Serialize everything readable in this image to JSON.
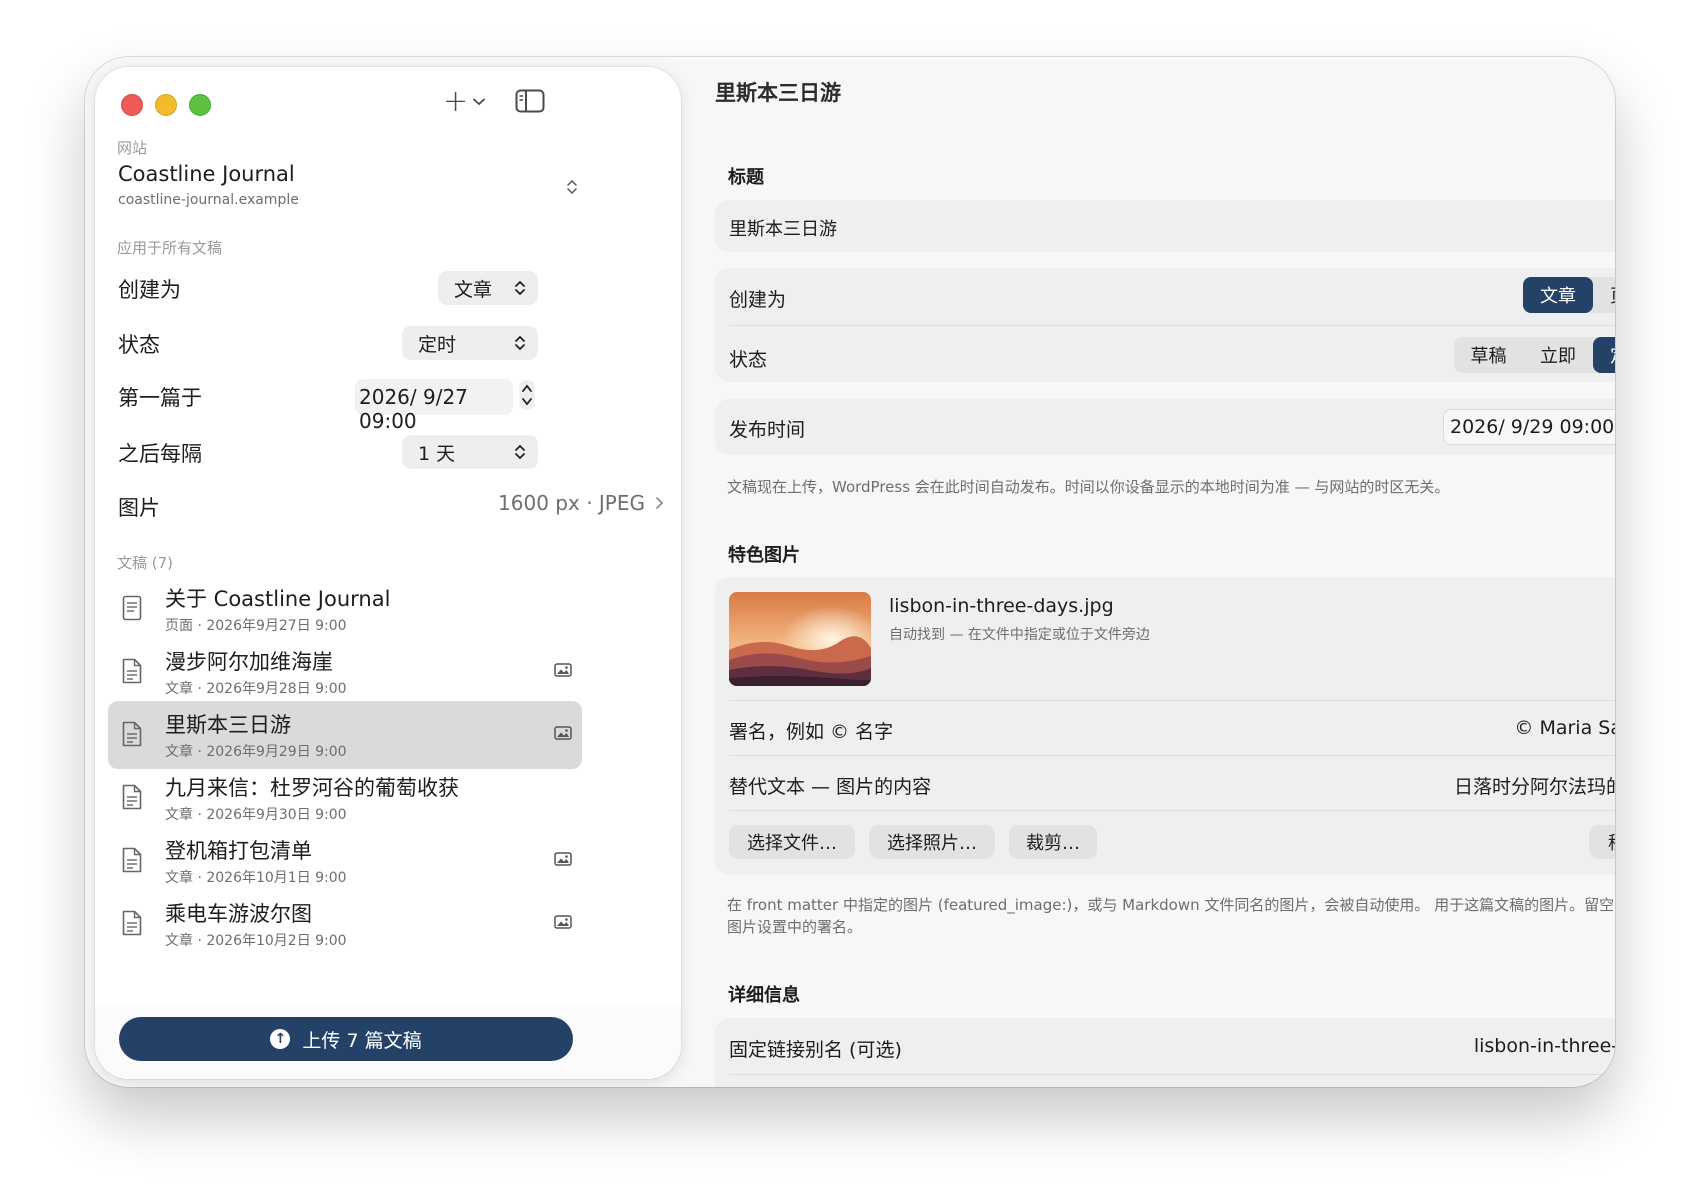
{
  "sidebar": {
    "add_label": "+",
    "site_section_label": "网站",
    "site_name": "Coastline Journal",
    "site_url": "coastline-journal.example",
    "apply_section_label": "应用于所有文稿",
    "create_as_label": "创建为",
    "create_as_value": "文章",
    "status_label": "状态",
    "status_value": "定时",
    "first_at_label": "第一篇于",
    "first_at_value": "2026/  9/27 09:00",
    "interval_label": "之后每隔",
    "interval_value": "1 天",
    "images_label": "图片",
    "images_value": "1600 px · JPEG",
    "docs_section_label": "文稿 (7)",
    "documents": [
      {
        "title": "关于 Coastline Journal",
        "subtitle": "页面 · 2026年9月27日 9:00",
        "icon": "page-icon",
        "has_image": false
      },
      {
        "title": "漫步阿尔加维海崖",
        "subtitle": "文章 · 2026年9月28日 9:00",
        "icon": "document-icon",
        "has_image": true
      },
      {
        "title": "里斯本三日游",
        "subtitle": "文章 · 2026年9月29日 9:00",
        "icon": "document-icon",
        "has_image": true,
        "selected": true
      },
      {
        "title": "九月来信：杜罗河谷的葡萄收获",
        "subtitle": "文章 · 2026年9月30日 9:00",
        "icon": "document-icon",
        "has_image": false
      },
      {
        "title": "登机箱打包清单",
        "subtitle": "文章 · 2026年10月1日 9:00",
        "icon": "document-icon",
        "has_image": true
      },
      {
        "title": "乘电车游波尔图",
        "subtitle": "文章 · 2026年10月2日 9:00",
        "icon": "document-icon",
        "has_image": true
      }
    ],
    "upload_label": "上传 7 篇文稿"
  },
  "main": {
    "title": "里斯本三日游",
    "title_section": "标题",
    "title_value": "里斯本三日游",
    "create_as_label": "创建为",
    "create_as_options": [
      "文章",
      "页面"
    ],
    "create_as_selected": "文章",
    "status_label": "状态",
    "status_options": [
      "草稿",
      "立即",
      "定时"
    ],
    "status_selected": "定时",
    "publish_time_label": "发布时间",
    "publish_time_value": "2026/  9/29 09:00",
    "publish_help": "文稿现在上传，WordPress 会在此时间自动发布。时间以你设备显示的本地时间为准 — 与网站的时区无关。",
    "featured_section": "特色图片",
    "image_filename": "lisbon-in-three-days.jpg",
    "image_found_note": "自动找到 — 在文件中指定或位于文件旁边",
    "credit_label": "署名，例如 © 名字",
    "credit_value": "© Maria Santos",
    "alt_label": "替代文本 — 图片的内容",
    "alt_value": "日落时分阿尔法玛的屋顶",
    "choose_file_label": "选择文件…",
    "choose_photo_label": "选择照片…",
    "crop_label": "裁剪…",
    "remove_label": "移除",
    "image_help": "在 front matter 中指定的图片 (featured_image:)，或与 Markdown 文件同名的图片，会被自动使用。 用于这篇文稿的图片。留空则使用图片设置中的署名。",
    "details_section": "详细信息",
    "slug_label": "固定链接别名 (可选)",
    "slug_value": "lisbon-in-three-days"
  },
  "colors": {
    "accent": "#244268",
    "close": "#ee5b56",
    "minimize": "#f2bb2d",
    "zoom": "#5dc142"
  }
}
